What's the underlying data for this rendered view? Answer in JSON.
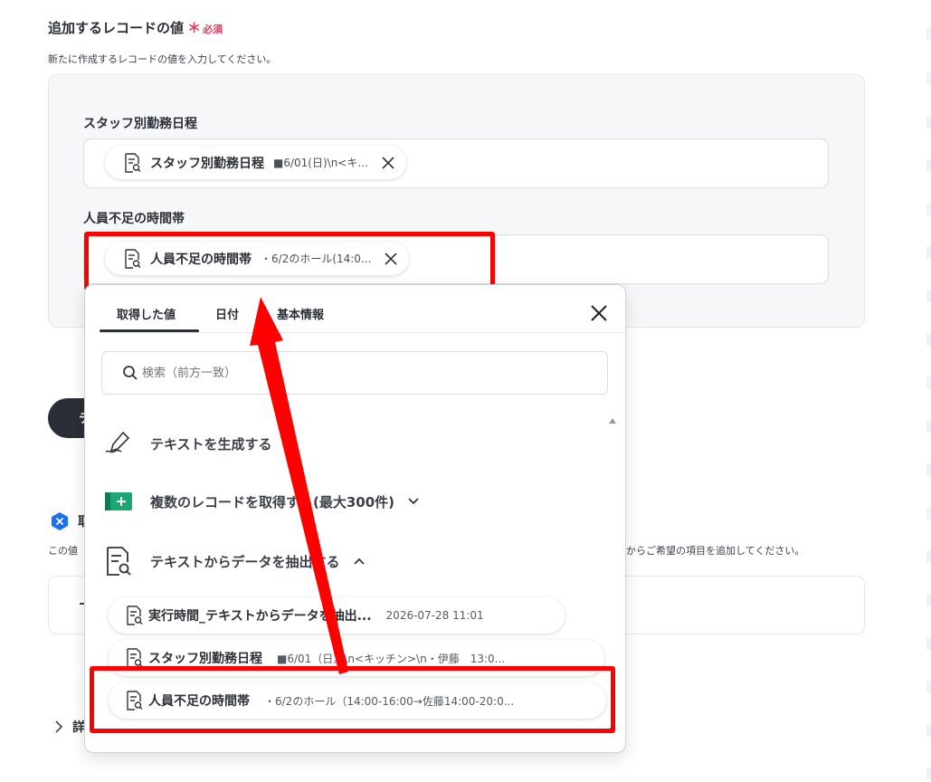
{
  "section": {
    "title": "追加するレコードの値",
    "required_star": "＊",
    "required_text": "必須",
    "description": "新たに作成するレコードの値を入力してください。"
  },
  "fields": [
    {
      "label": "スタッフ別勤務日程",
      "chip_name": "スタッフ別勤務日程",
      "chip_value": "■6/01(日)\\n<キ..."
    },
    {
      "label": "人員不足の時間帯",
      "chip_name": "人員不足の時間帯",
      "chip_value": "・6/2のホール(14:0..."
    }
  ],
  "side": {
    "heading_letter": "取",
    "desc_left": "この値",
    "desc_right": "からご希望の項目を追加してください。",
    "button_letter": "テ",
    "details_letter": "詳"
  },
  "dropdown": {
    "tabs": [
      "取得した値",
      "日付",
      "基本情報"
    ],
    "search_placeholder": "検索（前方一致）",
    "categories": [
      {
        "label": "テキストを生成する",
        "icon": "pen-icon",
        "expanded": false
      },
      {
        "label": "複数のレコードを取得する(最大300件)",
        "icon": "table-add-icon",
        "expanded": false
      },
      {
        "label": "テキストからデータを抽出する",
        "icon": "document-search-icon",
        "expanded": true
      }
    ],
    "items": [
      {
        "name": "実行時間_テキストからデータを抽出...",
        "value": "2026-07-28 11:01"
      },
      {
        "name": "スタッフ別勤務日程",
        "value": "■6/01（日）\\n<キッチン>\\n・伊藤　13:0..."
      },
      {
        "name": "人員不足の時間帯",
        "value": "・6/2のホール（14:00-16:00→佐藤14:00-20:0..."
      }
    ]
  },
  "colors": {
    "annotation_red": "#ff0000",
    "required_pink": "#e5375a",
    "dark_button": "#2a2e36",
    "badge_blue": "#1a73e8",
    "table_icon_green": "#1ba672"
  }
}
